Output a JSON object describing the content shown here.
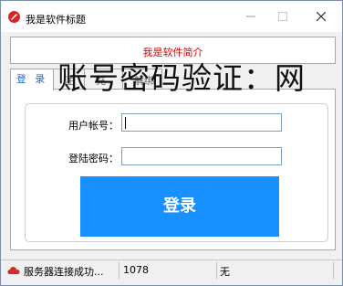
{
  "window": {
    "title": "我是软件标题",
    "intro": "我是软件简介"
  },
  "tabs": [
    {
      "label": "登 录"
    },
    {
      "label": "注"
    },
    {
      "label": "充"
    },
    {
      "label": "解绑"
    }
  ],
  "form": {
    "username_label": "用户帐号：",
    "password_label": "登陆密码：",
    "username_value": "",
    "password_value": "",
    "login_button": "登录"
  },
  "overlay_text": "账号密码验证：网",
  "status": {
    "server": "服务器连接成功...",
    "count": "1078",
    "extra": "无"
  },
  "colors": {
    "accent_blue": "#1890ff",
    "intro_red": "#e00000",
    "tab_blue": "#1c66d9"
  }
}
